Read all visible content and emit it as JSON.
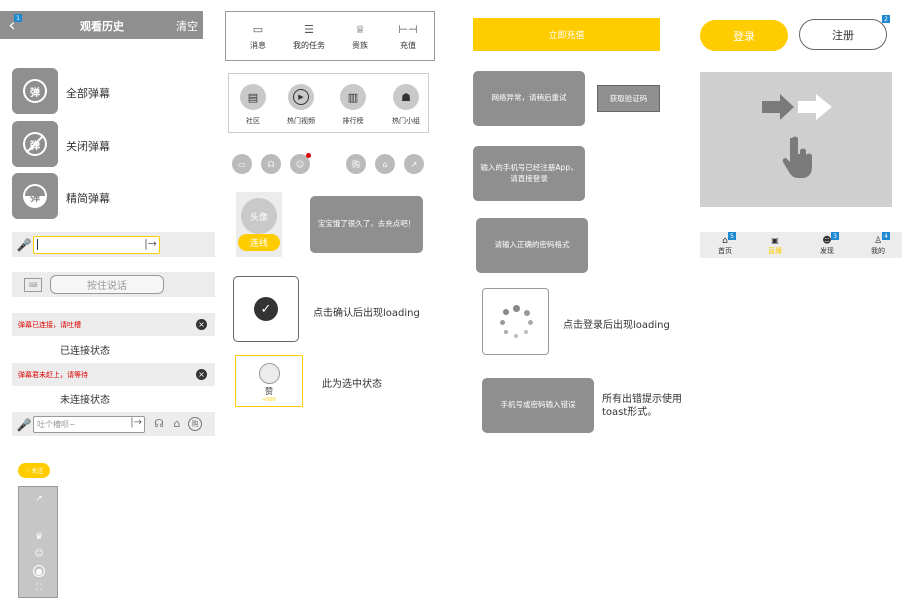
{
  "history": {
    "title": "观看历史",
    "clear": "清空",
    "badge": "1"
  },
  "danmaku": [
    {
      "label": "全部弹幕",
      "icon": "弹"
    },
    {
      "label": "关闭弹幕",
      "icon": "弹"
    },
    {
      "label": "精简弹幕",
      "icon": "弹"
    }
  ],
  "voice_hold": "按住说话",
  "status_connected": {
    "banner": "弹幕已连接，请吐槽",
    "caption": "已连接状态"
  },
  "status_unconnected": {
    "banner": "弹幕君未赶上，请等待",
    "caption": "未连接状态"
  },
  "bottom_input_placeholder": "吐个槽呗~",
  "bottom_buy": "购",
  "follow_button": "关注",
  "tabs_top": [
    "消息",
    "我的任务",
    "贵族",
    "充值"
  ],
  "tabs_second": [
    "社区",
    "热门视频",
    "排行榜",
    "热门小组"
  ],
  "small_icons": {
    "buy": "购"
  },
  "avatar": {
    "text": "头像",
    "button": "连线"
  },
  "hungry_toast": "宝宝饿了很久了，去充点吧！",
  "loading_caption": "点击确认后出现loading",
  "praise": {
    "label": "赞",
    "sub": "+500"
  },
  "selected_caption": "此为选中状态",
  "recharge_button": "立即充值",
  "toasts": {
    "network": "网络异常，请稍后重试",
    "get_code": "获取验证码",
    "registered": "输入的手机号已经注册App，请直接登录",
    "password_format": "请输入正确的密码格式",
    "phone_wrong": "手机号或密码输入错误"
  },
  "login_loading_caption": "点击登录后出现loading",
  "toast_note": "所有出错提示使用toast形式。",
  "login": "登录",
  "register": "注册",
  "badges": {
    "register": "2",
    "home": "5",
    "discover": "3",
    "mine": "4"
  },
  "bottom_nav": [
    {
      "label": "首页",
      "active": false
    },
    {
      "label": "直播",
      "active": true
    },
    {
      "label": "发现",
      "active": false
    },
    {
      "label": "我的",
      "active": false
    }
  ],
  "colors": {
    "accent": "#ffcc00",
    "grey": "#8f8f8f",
    "red": "#e00000",
    "blue": "#1f8ad2"
  }
}
